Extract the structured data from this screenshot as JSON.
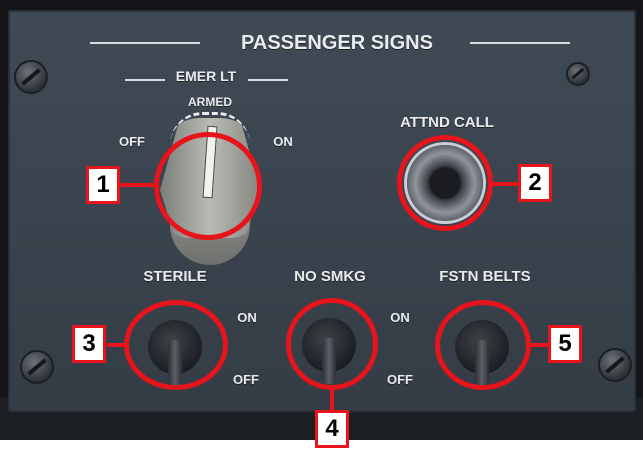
{
  "panel": {
    "title": "PASSENGER SIGNS",
    "emer_lt": {
      "label": "EMER LT",
      "positions": {
        "off": "OFF",
        "armed": "ARMED",
        "on": "ON"
      }
    },
    "attnd_call": {
      "label": "ATTND CALL"
    },
    "switches": [
      {
        "label": "STERILE"
      },
      {
        "label": "NO SMKG"
      },
      {
        "label": "FSTN BELTS"
      }
    ],
    "toggle_labels": {
      "left_on": "ON",
      "left_off": "OFF",
      "right_on": "ON",
      "right_off": "OFF"
    }
  },
  "callouts": [
    "1",
    "2",
    "3",
    "4",
    "5"
  ],
  "colors": {
    "callout": "#e8141c",
    "panel": "#3d4650",
    "text": "#e8ecef"
  },
  "icons": {
    "screw": "screw-icon",
    "jack": "attendant-call-jack-icon"
  }
}
